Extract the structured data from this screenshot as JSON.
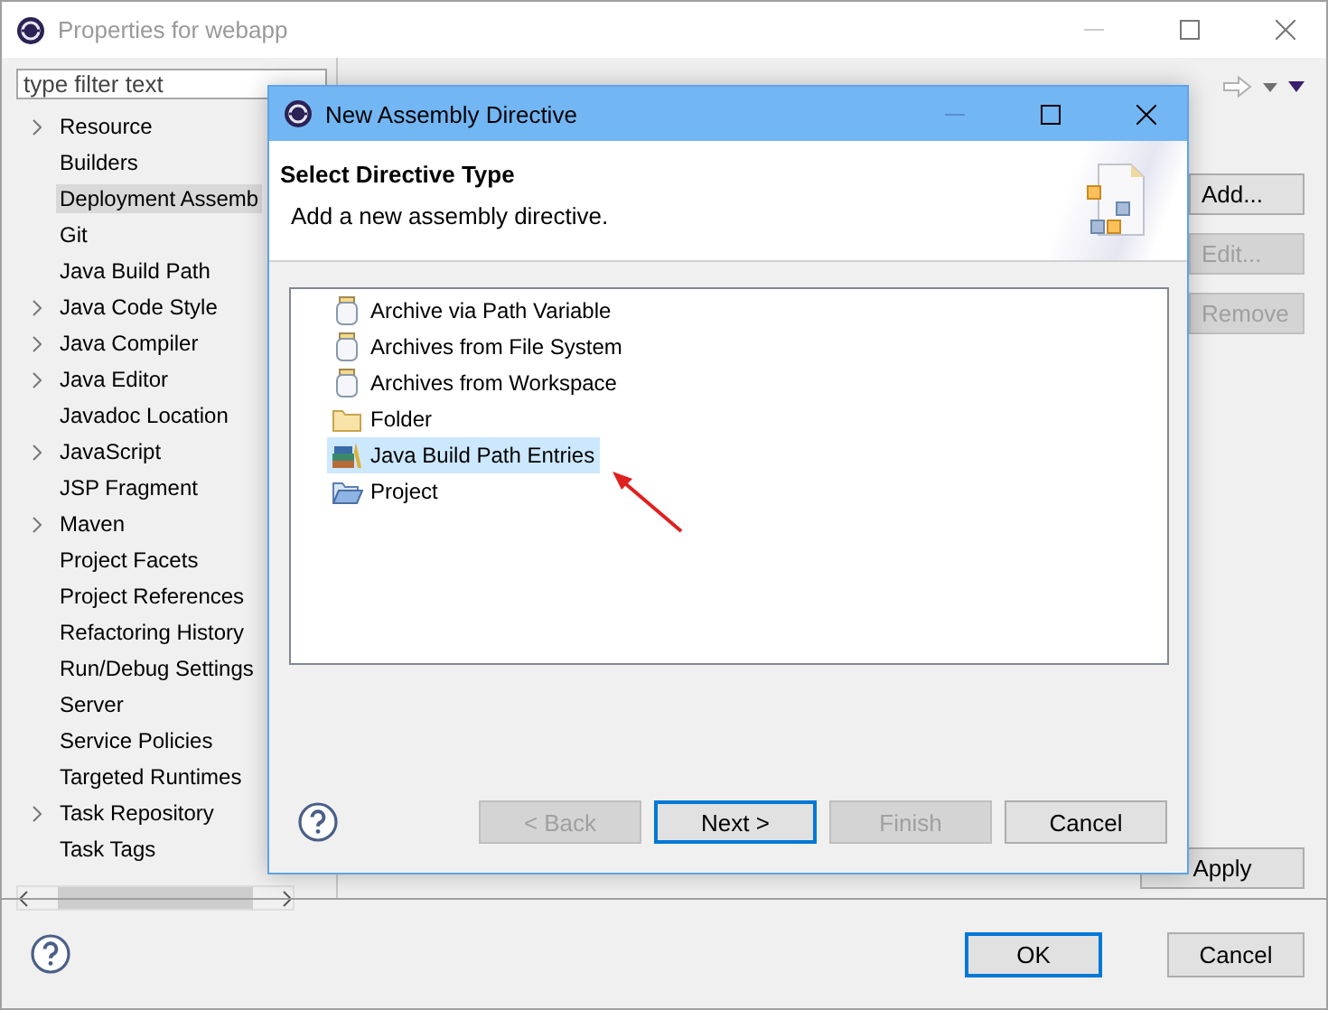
{
  "window": {
    "title": "Properties for webapp"
  },
  "filter": {
    "placeholder": "type filter text"
  },
  "tree": [
    {
      "label": "Resource",
      "expandable": true,
      "selected": false
    },
    {
      "label": "Builders",
      "expandable": false,
      "selected": false
    },
    {
      "label": "Deployment Assemb",
      "expandable": false,
      "selected": true
    },
    {
      "label": "Git",
      "expandable": false,
      "selected": false
    },
    {
      "label": "Java Build Path",
      "expandable": false,
      "selected": false
    },
    {
      "label": "Java Code Style",
      "expandable": true,
      "selected": false
    },
    {
      "label": "Java Compiler",
      "expandable": true,
      "selected": false
    },
    {
      "label": "Java Editor",
      "expandable": true,
      "selected": false
    },
    {
      "label": "Javadoc Location",
      "expandable": false,
      "selected": false
    },
    {
      "label": "JavaScript",
      "expandable": true,
      "selected": false
    },
    {
      "label": "JSP Fragment",
      "expandable": false,
      "selected": false
    },
    {
      "label": "Maven",
      "expandable": true,
      "selected": false
    },
    {
      "label": "Project Facets",
      "expandable": false,
      "selected": false
    },
    {
      "label": "Project References",
      "expandable": false,
      "selected": false
    },
    {
      "label": "Refactoring History",
      "expandable": false,
      "selected": false
    },
    {
      "label": "Run/Debug Settings",
      "expandable": false,
      "selected": false
    },
    {
      "label": "Server",
      "expandable": false,
      "selected": false
    },
    {
      "label": "Service Policies",
      "expandable": false,
      "selected": false
    },
    {
      "label": "Targeted Runtimes",
      "expandable": false,
      "selected": false
    },
    {
      "label": "Task Repository",
      "expandable": true,
      "selected": false
    },
    {
      "label": "Task Tags",
      "expandable": false,
      "selected": false
    }
  ],
  "side_buttons": [
    {
      "label": "Add...",
      "disabled": false
    },
    {
      "label": "Edit...",
      "disabled": true
    },
    {
      "label": "Remove",
      "disabled": true
    }
  ],
  "apply_button": {
    "label": "Apply"
  },
  "footer_buttons": [
    {
      "label": "OK",
      "default": true
    },
    {
      "label": "Cancel",
      "default": false
    }
  ],
  "dialog": {
    "title": "New Assembly Directive",
    "heading": "Select Directive Type",
    "description": "Add a new assembly directive.",
    "items": [
      {
        "label": "Archive via Path Variable",
        "kind": "jar",
        "selected": false
      },
      {
        "label": "Archives from File System",
        "kind": "jar",
        "selected": false
      },
      {
        "label": "Archives from Workspace",
        "kind": "jar",
        "selected": false
      },
      {
        "label": "Folder",
        "kind": "folder",
        "selected": false
      },
      {
        "label": "Java Build Path Entries",
        "kind": "library",
        "selected": true
      },
      {
        "label": "Project",
        "kind": "open-folder",
        "selected": false
      }
    ],
    "buttons": [
      {
        "label": "< Back",
        "disabled": true,
        "default": false
      },
      {
        "label": "Next >",
        "disabled": false,
        "default": true
      },
      {
        "label": "Finish",
        "disabled": true,
        "default": false
      },
      {
        "label": "Cancel",
        "disabled": false,
        "default": false
      }
    ]
  }
}
